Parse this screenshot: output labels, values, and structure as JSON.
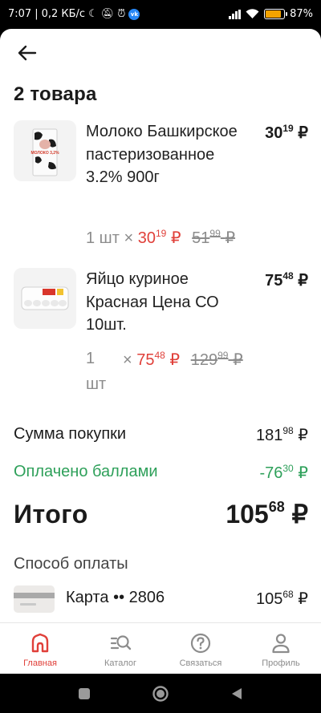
{
  "status": {
    "time": "7:07",
    "speed": "0,2 КБ/с",
    "vk": "vk",
    "battery": "87%",
    "battery_level": 0.87
  },
  "header": {
    "title": "2 товара"
  },
  "items": [
    {
      "name": "Молоко Башкирское пастеризованное 3.2% 900г",
      "total_int": "30",
      "total_frac": "19",
      "qty": "1 шт",
      "times": "×",
      "price_int": "30",
      "price_frac": "19",
      "old_int": "51",
      "old_frac": "99",
      "pack_text": "МОЛОКО 3,2%"
    },
    {
      "name": "Яйцо куриное Красная Цена СО 10шт.",
      "total_int": "75",
      "total_frac": "48",
      "qty_num": "1",
      "qty_unit": "шт",
      "times": "×",
      "price_int": "75",
      "price_frac": "48",
      "old_int": "129",
      "old_frac": "99"
    }
  ],
  "currency": "₽",
  "summary": {
    "purchase_label": "Сумма покупки",
    "purchase_int": "181",
    "purchase_frac": "98",
    "points_label": "Оплачено баллами",
    "points_int": "-76",
    "points_frac": "30",
    "total_label": "Итого",
    "total_int": "105",
    "total_frac": "68"
  },
  "payment": {
    "title": "Способ оплаты",
    "card_label": "Карта •• 2806",
    "sum_int": "105",
    "sum_frac": "68"
  },
  "nav": {
    "home": "Главная",
    "catalog": "Каталог",
    "contact": "Связаться",
    "profile": "Профиль"
  },
  "colors": {
    "accent": "#e0403a",
    "green": "#2ea05a",
    "muted": "#8c8c8c"
  }
}
